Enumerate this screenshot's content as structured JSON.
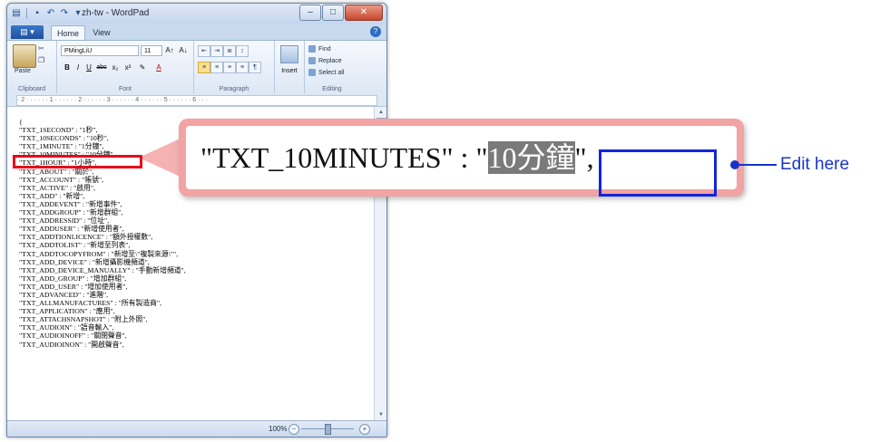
{
  "window": {
    "title": "zh-tw - WordPad",
    "minimize": "–",
    "maximize": "□",
    "close": "✕"
  },
  "ribbon": {
    "app_menu": "▤ ▾",
    "tabs": [
      "Home",
      "View"
    ],
    "clipboard": {
      "paste": "Paste",
      "label": "Clipboard"
    },
    "font": {
      "family": "PMingLiU",
      "size": "11",
      "label": "Font",
      "buttons": [
        "B",
        "I",
        "U",
        "abc",
        "x₂",
        "x²",
        "✎",
        "A"
      ]
    },
    "paragraph": {
      "label": "Paragraph"
    },
    "insert": {
      "label": "Insert"
    },
    "editing": {
      "find": "Find",
      "replace": "Replace",
      "select_all": "Select all",
      "label": "Editing"
    }
  },
  "ruler": "· 2 · · · · · · 1 · · · · · · 2 · · · · · · 3 · · · · · · 4 · · · · · · 5 · · · · · · 6 · · ·",
  "document": {
    "lines": [
      "{",
      "\"TXT_1SECOND\"    : \"1秒\",",
      "\"TXT_10SECONDS\" : \"10秒\",",
      "\"TXT_1MINUTE\" : \"1分鐘\",",
      "\"TXT_10MINUTES\" : \"10分鐘\",",
      "\"TXT_1HOUR\" : \"1小時\",",
      "\"TXT_ABOUT\" : \"關於\",",
      "\"TXT_ACCOUNT\" : \"帳號\",",
      "\"TXT_ACTIVE\" : \"啟用\",",
      "\"TXT_ADD\" : \"新增\",",
      "\"TXT_ADDEVENT\" : \"新增事件\",",
      "\"TXT_ADDGROUP\" : \"新增群組\",",
      "\"TXT_ADDRESSID\" : \"位址\",",
      "\"TXT_ADDUSER\" : \"新增使用者\",",
      "\"TXT_ADDTIONLICENCE\" : \"額外授權數\",",
      "\"TXT_ADDTOLIST\" : \"新增至列表\",",
      "\"TXT_ADDTOCOPYFROM\" : \"新增至\\\"複製來源\\\"\",",
      "\"TXT_ADD_DEVICE\" : \"新增攝影機頻道\",",
      "\"TXT_ADD_DEVICE_MANUALLY\" : \"手動新增頻道\",",
      "\"TXT_ADD_GROUP\" : \"增加群組\",",
      "\"TXT_ADD_USER\" : \"增加使用者\",",
      "\"TXT_ADVANCED\" : \"進階\",",
      "\"TXT_ALLMANUFACTURES\" : \"所有製造商\",",
      "\"TXT_APPLICATION\" : \"應用\",",
      "\"TXT_ATTACHSNAPSHOT\" : \"附上外照\",",
      "\"TXT_AUDIOIN\" : \"語音輸入\",",
      "\"TXT_AUDIOINOFF\" : \"關閉聲音\",",
      "\"TXT_AUDIOINON\" : \"開啟聲音\","
    ]
  },
  "status": {
    "zoom": "100%",
    "zoom_out": "−",
    "zoom_in": "+"
  },
  "callout": {
    "prefix": "\"TXT_10MINUTES\"  : \"",
    "selected": "10分鐘",
    "suffix": "\","
  },
  "annotation": {
    "label": "Edit here"
  },
  "colors": {
    "highlight_red": "#e8061a",
    "callout_pink": "#f2a3a3",
    "annotation_blue": "#1734c9"
  }
}
